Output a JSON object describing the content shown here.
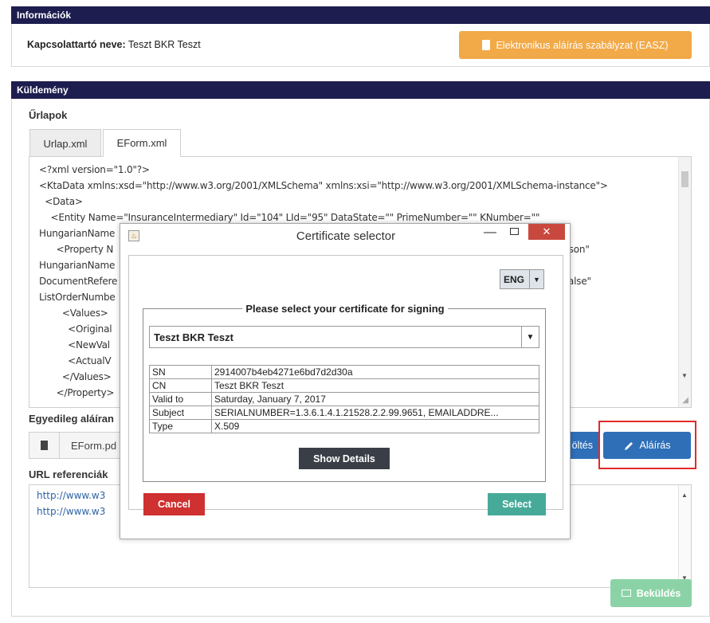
{
  "info": {
    "header": "Információk",
    "contact_label": "Kapcsolattartó neve:",
    "contact_value": "Teszt BKR Teszt",
    "policy_button": "Elektronikus aláírás szabályzat (EASZ)"
  },
  "shipment": {
    "header": "Küldemény",
    "forms_label": "Űrlapok",
    "tabs": [
      "Urlap.xml",
      "EForm.xml"
    ],
    "xml_lines": [
      "<?xml version=\"1.0\"?>",
      "<KtaData xmlns:xsd=\"http://www.w3.org/2001/XMLSchema\" xmlns:xsi=\"http://www.w3.org/2001/XMLSchema-instance\">",
      "  <Data>",
      "    <Entity Name=\"InsuranceIntermediary\" Id=\"104\" LId=\"95\" DataState=\"\" PrimeNumber=\"\" KNumber=\"\"",
      "HungarianName",
      "      <Property N",
      "HungarianName",
      "DocumentRefere",
      "ListOrderNumbe",
      "        <Values>",
      "          <Original",
      "          <NewVal",
      "          <ActualV",
      "        </Values>",
      "      </Property>"
    ],
    "xml_right_fragments": [
      "rson\"",
      "alse\""
    ],
    "individual_sign_label": "Egyedileg aláíran",
    "file_name": "EForm.pd",
    "download_label_partial": "öltés",
    "sign_button": "Aláírás",
    "url_label": "URL referenciák",
    "urls": [
      "http://www.w3",
      "http://www.w3"
    ],
    "send_button": "Beküldés"
  },
  "dialog": {
    "title": "Certificate selector",
    "close_symbol": "✕",
    "minimize_symbol": "—",
    "language": "ENG",
    "legend": "Please select your certificate for signing",
    "selected_cert": "Teszt BKR Teszt",
    "cert_rows": [
      {
        "key": "SN",
        "value": "2914007b4eb4271e6bd7d2d30a"
      },
      {
        "key": "CN",
        "value": "Teszt BKR Teszt"
      },
      {
        "key": "Valid to",
        "value": "Saturday, January 7, 2017"
      },
      {
        "key": "Subject",
        "value": "SERIALNUMBER=1.3.6.1.4.1.21528.2.2.99.9651, EMAILADDRE..."
      },
      {
        "key": "Type",
        "value": "X.509"
      }
    ],
    "show_details": "Show Details",
    "cancel": "Cancel",
    "select": "Select"
  },
  "colors": {
    "header_bg": "#1d1d4f",
    "orange": "#f2a947",
    "blue": "#2e6fb8",
    "cancel_red": "#cf3030",
    "select_teal": "#47aa99",
    "send_green": "#8bd3a6",
    "highlight_red": "#e22a2a"
  },
  "icons": {
    "policy": "document-icon",
    "sign": "pencil-icon",
    "send": "envelope-icon",
    "file": "file-icon",
    "app": "java-icon"
  }
}
